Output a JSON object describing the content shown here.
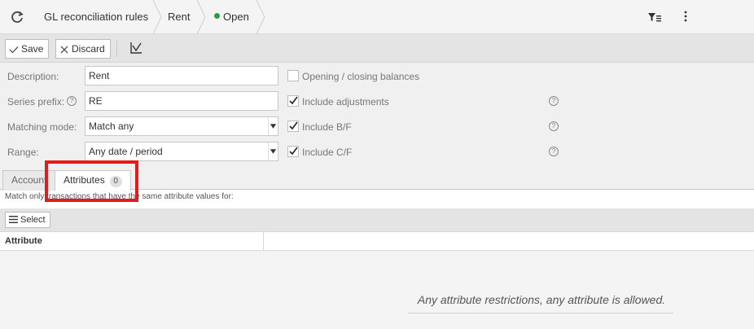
{
  "breadcrumb": {
    "items": [
      "GL reconciliation rules",
      "Rent"
    ],
    "status": "Open",
    "status_color": "#2e9e3c"
  },
  "toolbar": {
    "save_label": "Save",
    "discard_label": "Discard"
  },
  "form": {
    "description": {
      "label": "Description:",
      "value": "Rent"
    },
    "series_prefix": {
      "label": "Series prefix:",
      "value": "RE"
    },
    "matching_mode": {
      "label": "Matching mode:",
      "value": "Match any"
    },
    "range": {
      "label": "Range:",
      "value": "Any date / period"
    },
    "checkboxes": [
      {
        "label": "Opening / closing balances",
        "checked": false
      },
      {
        "label": "Include adjustments",
        "checked": true
      },
      {
        "label": "Include B/F",
        "checked": true
      },
      {
        "label": "Include C/F",
        "checked": true
      }
    ]
  },
  "tabs": [
    {
      "label": "Account",
      "active": false
    },
    {
      "label": "Attributes",
      "active": true,
      "badge": "0"
    }
  ],
  "attributes": {
    "hint": "Match only transactions that have the same attribute values for:",
    "select_label": "Select",
    "column_header": "Attribute",
    "empty_message": "Any attribute restrictions, any attribute is allowed."
  },
  "icons": [
    "refresh-icon",
    "filter-icon",
    "more-vertical-icon",
    "check-icon",
    "close-icon",
    "chart-icon",
    "help-icon",
    "menu-icon"
  ],
  "colors": {
    "highlight": "#e31b1b",
    "accent": "#2e9e3c"
  }
}
